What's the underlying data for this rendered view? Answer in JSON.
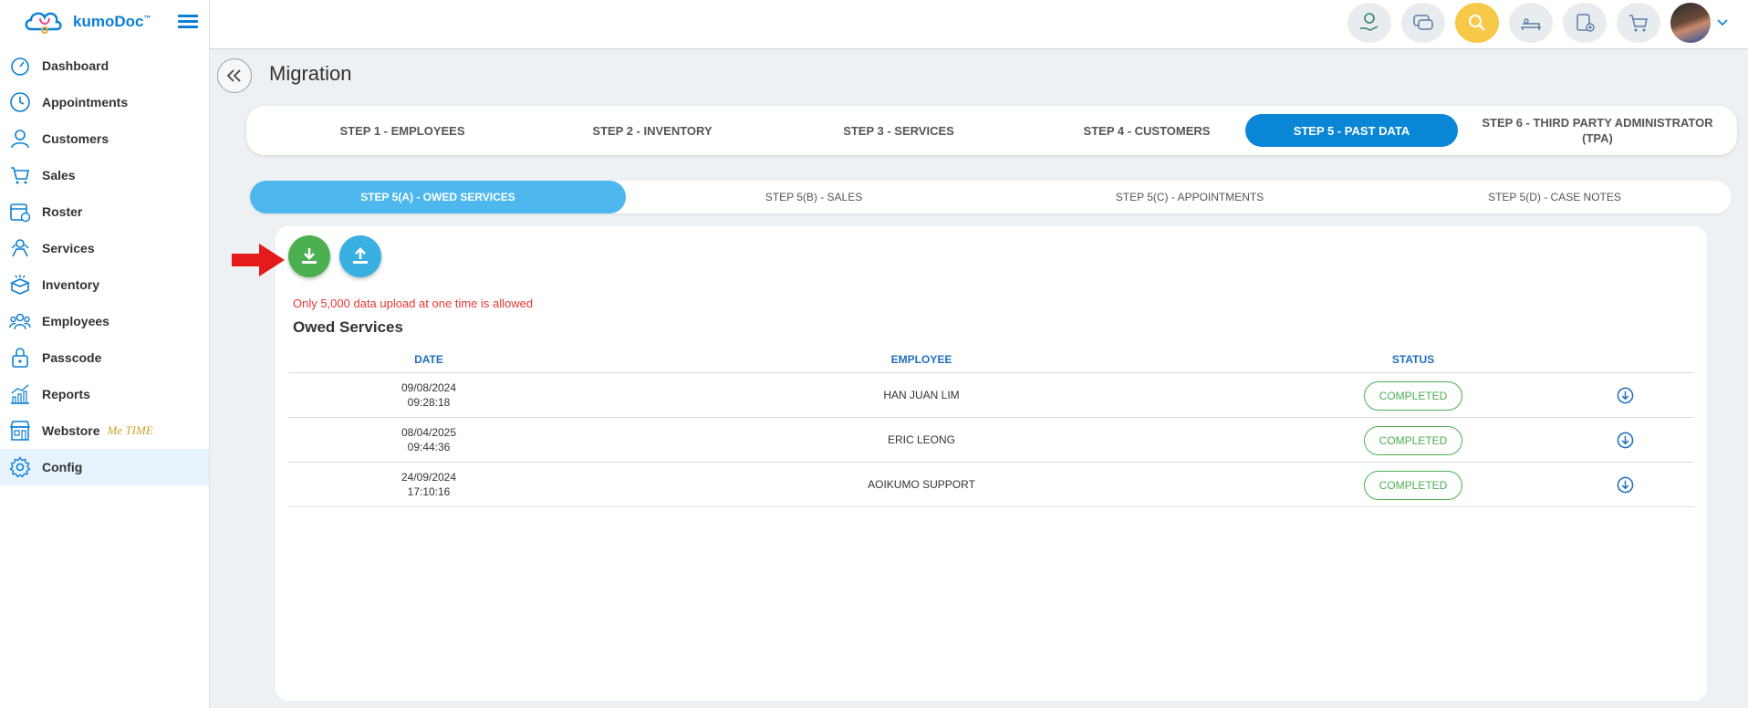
{
  "brand": {
    "name": "kumoDoc",
    "tm": "™"
  },
  "sidebar": {
    "items": [
      {
        "label": "Dashboard",
        "icon": "gauge-icon"
      },
      {
        "label": "Appointments",
        "icon": "clock-icon"
      },
      {
        "label": "Customers",
        "icon": "user-icon"
      },
      {
        "label": "Sales",
        "icon": "cart-icon"
      },
      {
        "label": "Roster",
        "icon": "calendar-clock-icon"
      },
      {
        "label": "Services",
        "icon": "services-icon"
      },
      {
        "label": "Inventory",
        "icon": "box-icon"
      },
      {
        "label": "Employees",
        "icon": "team-icon"
      },
      {
        "label": "Passcode",
        "icon": "lock-icon"
      },
      {
        "label": "Reports",
        "icon": "chart-icon"
      },
      {
        "label": "Webstore",
        "icon": "store-icon",
        "extra": "Me TIME"
      },
      {
        "label": "Config",
        "icon": "gear-icon",
        "active": true
      }
    ]
  },
  "page": {
    "title": "Migration"
  },
  "steps": [
    {
      "label": "STEP 1 - EMPLOYEES"
    },
    {
      "label": "STEP 2 - INVENTORY"
    },
    {
      "label": "STEP 3 - SERVICES"
    },
    {
      "label": "STEP 4 - CUSTOMERS"
    },
    {
      "label": "STEP 5 - PAST DATA",
      "active": true
    },
    {
      "label": "STEP 6 - THIRD PARTY ADMINISTRATOR (TPA)"
    }
  ],
  "substeps": [
    {
      "label": "STEP 5(A) - OWED SERVICES",
      "active": true
    },
    {
      "label": "STEP 5(B) - SALES"
    },
    {
      "label": "STEP 5(C) - APPOINTMENTS"
    },
    {
      "label": "STEP 5(D) - CASE NOTES"
    }
  ],
  "upload": {
    "limit_note": "Only 5,000 data upload at one time is allowed",
    "section_title": "Owed Services"
  },
  "table": {
    "headers": {
      "date": "DATE",
      "employee": "EMPLOYEE",
      "status": "STATUS"
    },
    "rows": [
      {
        "date": "09/08/2024",
        "time": "09:28:18",
        "employee": "HAN JUAN LIM",
        "status": "COMPLETED"
      },
      {
        "date": "08/04/2025",
        "time": "09:44:36",
        "employee": "ERIC LEONG",
        "status": "COMPLETED"
      },
      {
        "date": "24/09/2024",
        "time": "17:10:16",
        "employee": "AOIKUMO SUPPORT",
        "status": "COMPLETED"
      }
    ]
  },
  "colors": {
    "primary": "#0a86d6",
    "accent": "#4db7ee",
    "success": "#4caf50",
    "warning": "#e53935"
  }
}
